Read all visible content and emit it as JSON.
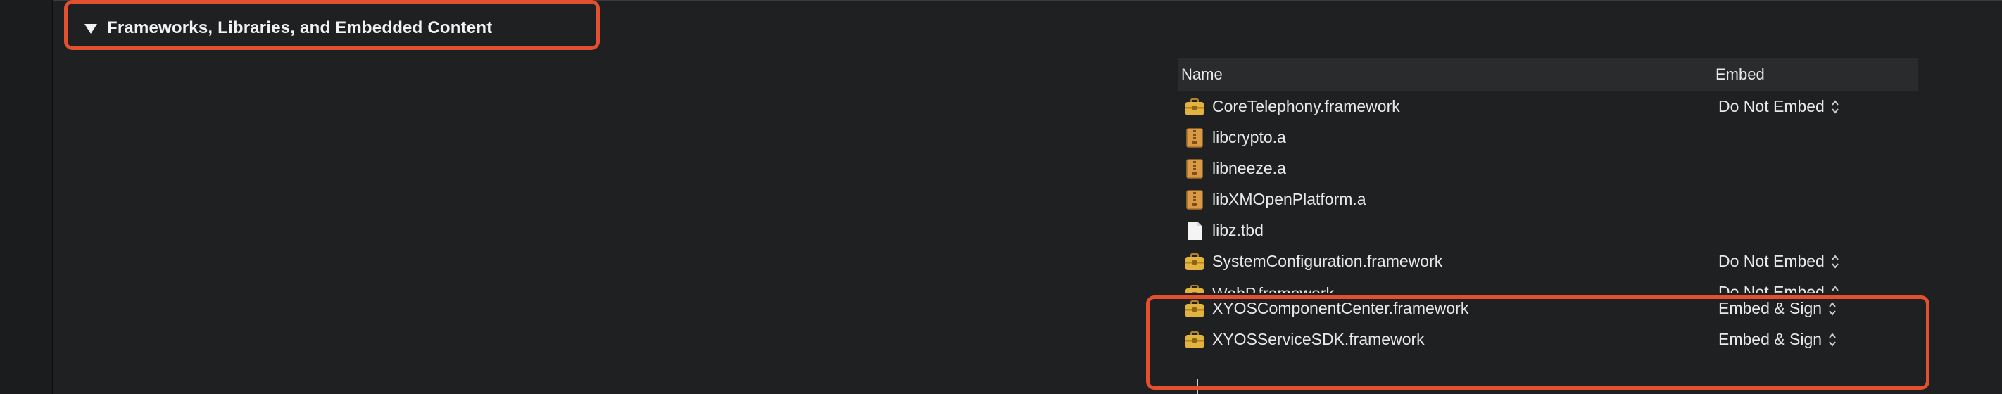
{
  "section": {
    "title": "Frameworks, Libraries, and Embedded Content"
  },
  "table": {
    "headers": {
      "name": "Name",
      "embed": "Embed"
    },
    "rows": [
      {
        "name": "CoreTelephony.framework",
        "kind": "framework",
        "embed": "Do Not Embed"
      },
      {
        "name": "libcrypto.a",
        "kind": "static-library",
        "embed": ""
      },
      {
        "name": "libneeze.a",
        "kind": "static-library",
        "embed": ""
      },
      {
        "name": "libXMOpenPlatform.a",
        "kind": "static-library",
        "embed": ""
      },
      {
        "name": "libz.tbd",
        "kind": "text-based-library",
        "embed": ""
      },
      {
        "name": "SystemConfiguration.framework",
        "kind": "framework",
        "embed": "Do Not Embed"
      },
      {
        "name": "WebP.framework",
        "kind": "framework",
        "embed": "Do Not Embed"
      },
      {
        "name": "XYOSComponentCenter.framework",
        "kind": "framework",
        "embed": "Embed & Sign"
      },
      {
        "name": "XYOSServiceSDK.framework",
        "kind": "framework",
        "embed": "Embed & Sign"
      }
    ]
  },
  "icons": {
    "disclosure": "disclosure-triangle-down-icon",
    "framework": "framework-toolbox-icon",
    "static_library": "static-library-archive-icon",
    "text_based_library": "document-file-icon",
    "stepper": "up-down-chevron-icon"
  },
  "colors": {
    "background": "#1f2022",
    "highlight": "#e2502f",
    "framework_icon": "#e3b341",
    "text": "#e8e8e8"
  }
}
